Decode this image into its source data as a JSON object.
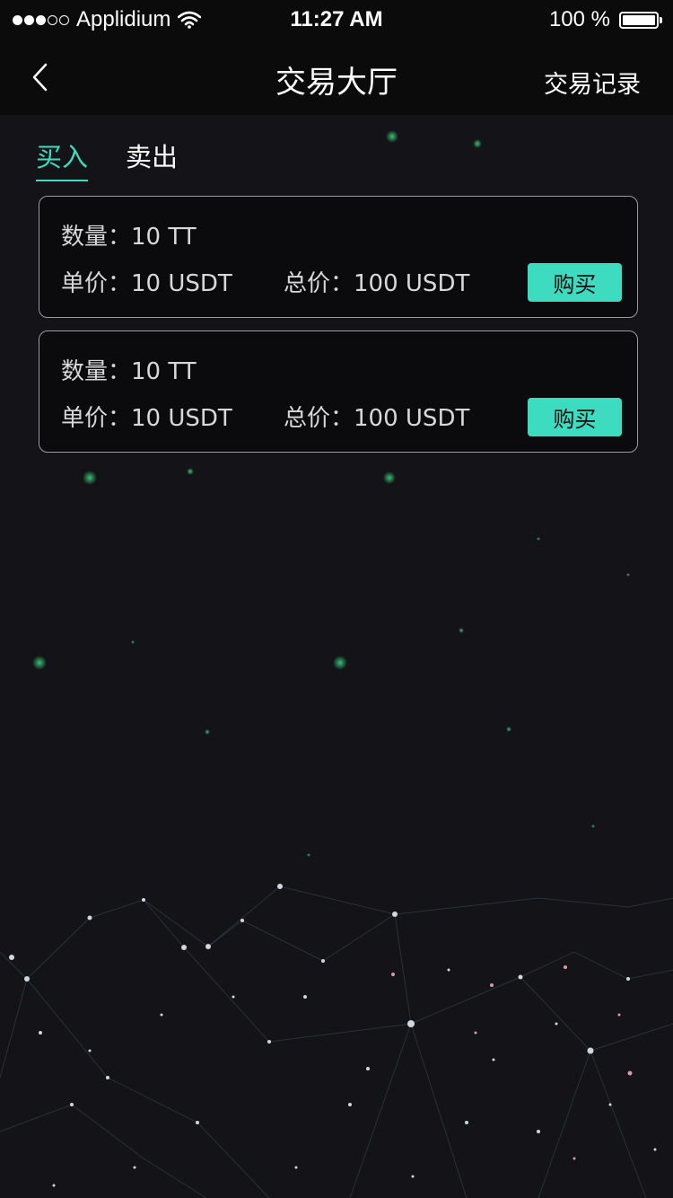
{
  "status_bar": {
    "carrier": "Applidium",
    "time": "11:27 AM",
    "battery": "100 %",
    "signal_bars": 3
  },
  "nav": {
    "title": "交易大厅",
    "right_link": "交易记录",
    "back_icon": "chevron-left-icon"
  },
  "tabs": [
    {
      "label": "买入",
      "active": true
    },
    {
      "label": "卖出",
      "active": false
    }
  ],
  "orders": [
    {
      "quantity_label": "数量：",
      "quantity": "10 TT",
      "unit_price_label": "单价：",
      "unit_price": "10 USDT",
      "total_label": "总价：",
      "total": "100 USDT",
      "button": "购买"
    },
    {
      "quantity_label": "数量：",
      "quantity": "10 TT",
      "unit_price_label": "单价：",
      "unit_price": "10 USDT",
      "total_label": "总价：",
      "total": "100 USDT",
      "button": "购买"
    }
  ],
  "colors": {
    "accent": "#3ddcc1",
    "background": "#141318",
    "bar": "#0b0b0c"
  }
}
